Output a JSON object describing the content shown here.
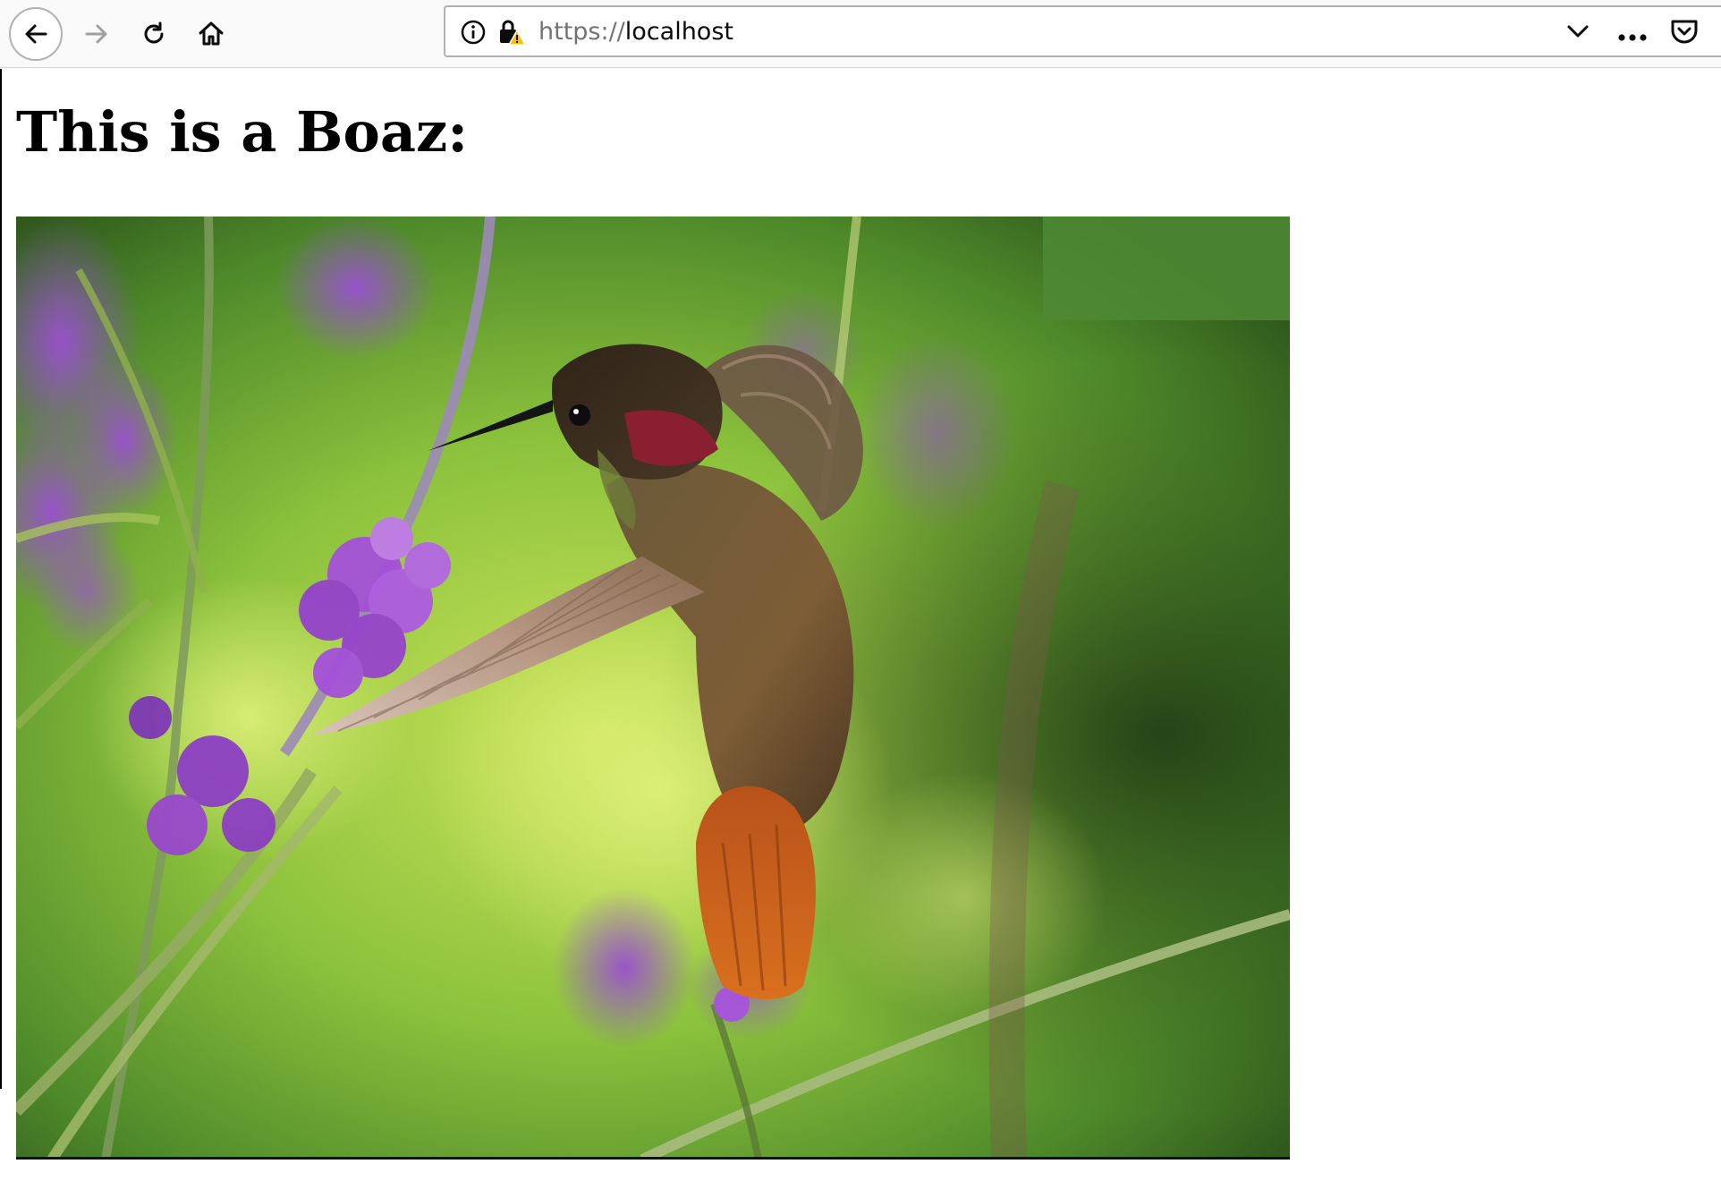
{
  "browser": {
    "url_scheme": "https://",
    "url_host": "localhost"
  },
  "page": {
    "heading": "This is a Boaz:"
  },
  "image": {
    "subject": "hummingbird-photo"
  },
  "colors": {
    "toolbar_bg": "#f9f9fa",
    "urlbar_border": "#b1b1b3",
    "heading": "#000000"
  }
}
